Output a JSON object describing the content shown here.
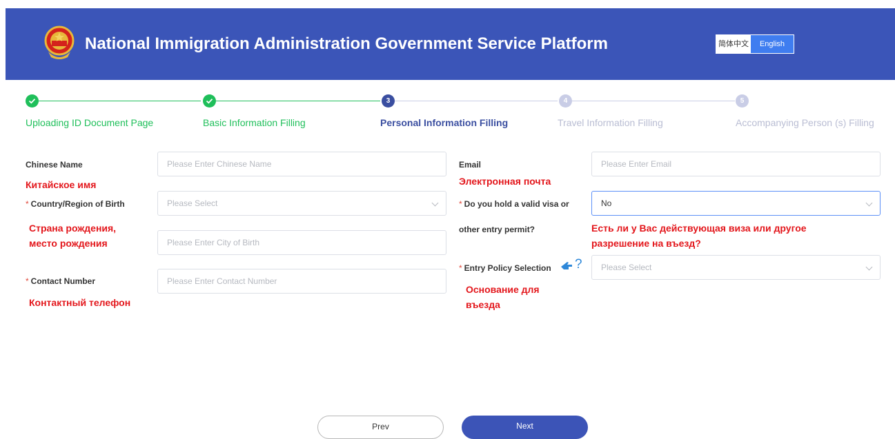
{
  "header": {
    "title": "National Immigration Administration Government Service Platform",
    "lang_cn": "简体中文",
    "lang_en": "English",
    "color": "#3b55b8"
  },
  "steps": [
    {
      "number": "",
      "label": "Uploading ID Document Page",
      "state": "done"
    },
    {
      "number": "",
      "label": "Basic Information Filling",
      "state": "done"
    },
    {
      "number": "3",
      "label": "Personal Information Filling",
      "state": "current"
    },
    {
      "number": "4",
      "label": "Travel Information Filling",
      "state": "pending"
    },
    {
      "number": "5",
      "label": "Accompanying Person (s) Filling",
      "state": "pending"
    }
  ],
  "form": {
    "chinese_name": {
      "label": "Chinese Name",
      "placeholder": "Please Enter Chinese Name",
      "note": "Китайское имя"
    },
    "country_birth": {
      "label": "Country/Region of Birth",
      "placeholder": "Please Select",
      "note": "Страна рождения, место рождения"
    },
    "city_birth": {
      "placeholder": "Please Enter City of Birth"
    },
    "contact": {
      "label": "Contact Number",
      "placeholder": "Please Enter Contact Number",
      "note": "Контактный телефон"
    },
    "email": {
      "label": "Email",
      "placeholder": "Please Enter Email",
      "note": "Электронная почта"
    },
    "visa": {
      "label_line1": "Do you hold a valid visa or",
      "label_line2": "other entry permit?",
      "value": "No",
      "note": "Есть ли у Вас действующая виза или другое разрешение на въезд?"
    },
    "entry_policy": {
      "label": "Entry Policy Selection",
      "help": "?",
      "placeholder": "Please Select",
      "note": "Основание для въезда"
    }
  },
  "buttons": {
    "prev": "Prev",
    "next": "Next"
  },
  "colors": {
    "done": "#1fbf5a",
    "current": "#3a4ea0",
    "pending": "#c9cde6",
    "note": "#e3161b",
    "accent": "#3b55b8"
  }
}
